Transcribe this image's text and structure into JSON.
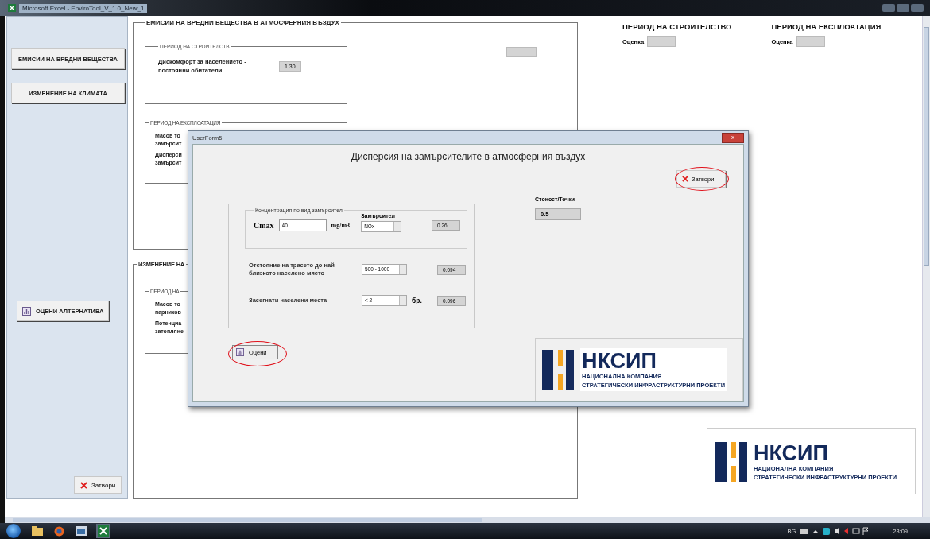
{
  "window": {
    "title": "Microsoft Excel - EnviroTool_V_1.0_New_1"
  },
  "sidebar": {
    "buttons": [
      {
        "label": "ЕМИСИИ НА ВРЕДНИ ВЕЩЕСТВА",
        "kind": "text"
      },
      {
        "label": "ИЗМЕНЕНИЕ НА КЛИМАТА",
        "kind": "text"
      },
      {
        "label": "ОЦЕНИ АЛТЕРНАТИВА",
        "kind": "chart"
      }
    ],
    "close_button": "Затвори"
  },
  "emissions_panel": {
    "title": "ЕМИСИИ НА ВРЕДНИ ВЕЩЕСТВА В АТМОСФЕРНИЯ ВЪЗДУХ",
    "construction": {
      "title": "ПЕРИОД НА СТРОИТЕЛСТВ",
      "label": "Дискомфорт за населението - постоянни обитатели",
      "value": "1.30"
    },
    "operation": {
      "title": "ПЕРИОД НА ЕКСПЛОАТАЦИЯ",
      "items": [
        [
          "Масов то",
          "замърсит"
        ],
        [
          "Дисперси",
          "замърсит"
        ]
      ]
    }
  },
  "climate_panel": {
    "title": "ИЗМЕНЕНИЕ НА",
    "group_title": "ПЕРИОД НА",
    "items": [
      [
        "Масов то",
        "парников"
      ],
      [
        "Потенциа",
        "затопляне"
      ]
    ]
  },
  "periods": [
    {
      "title": "ПЕРИОД НА СТРОИТЕЛСТВО",
      "label": "Оценка"
    },
    {
      "title": "ПЕРИОД НА ЕКСПЛОАТАЦИЯ",
      "label": "Оценка"
    }
  ],
  "logo": {
    "name": "НКСИП",
    "line1": "НАЦИОНАЛНА КОМПАНИЯ",
    "line2": "СТРАТЕГИЧЕСКИ ИНФРАСТРУКТУРНИ ПРОЕКТИ"
  },
  "dialog": {
    "title": "UserForm5",
    "close_glyph": "x",
    "heading": "Дисперсия на замърсителите в атмосферния въздух",
    "close_button": "Затвори",
    "score_label": "Стоност/Точки",
    "score": "0.5",
    "group_title": "Концентрация по вид замърсител",
    "pollutant_label": "Замърсител",
    "cmax_label": "Cmax",
    "cmax_value": "40",
    "unit": "mg/m3",
    "pollutant": "NOx",
    "cmax_result": "0.26",
    "rows": [
      {
        "label": "Отстояние на трасето до най-близкото населено място",
        "choice": "500 - 1000",
        "unit": "",
        "result": "0.094"
      },
      {
        "label": "Засегнати населени места",
        "choice": "< 2",
        "unit": "бр.",
        "result": "0.096"
      }
    ],
    "evaluate_button": "Оцени",
    "logo": {
      "name": "НКСИП",
      "line1": "НАЦИОНАЛНА КОМПАНИЯ",
      "line2": "СТРАТЕГИЧЕСКИ ИНФРАСТРУКТУРНИ ПРОЕКТИ"
    }
  },
  "taskbar": {
    "language": "BG",
    "time": "23:09"
  }
}
